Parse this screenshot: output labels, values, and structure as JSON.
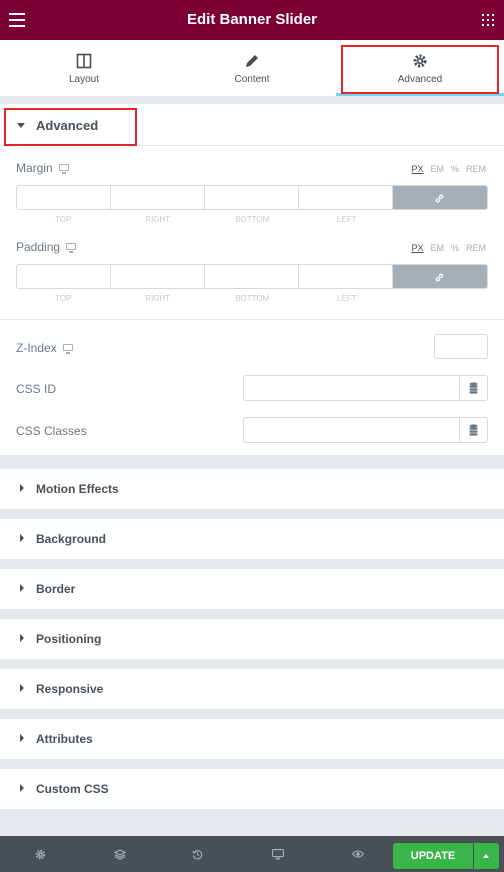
{
  "header": {
    "title": "Edit Banner Slider"
  },
  "tabs": [
    {
      "label": "Layout",
      "icon": "columns-icon"
    },
    {
      "label": "Content",
      "icon": "pencil-icon"
    },
    {
      "label": "Advanced",
      "icon": "gear-icon",
      "active": true
    }
  ],
  "advanced": {
    "title": "Advanced",
    "margin": {
      "label": "Margin",
      "units": [
        "PX",
        "EM",
        "%",
        "REM"
      ],
      "selected_unit": "PX",
      "fields": [
        "TOP",
        "RIGHT",
        "BOTTOM",
        "LEFT"
      ]
    },
    "padding": {
      "label": "Padding",
      "units": [
        "PX",
        "EM",
        "%",
        "REM"
      ],
      "selected_unit": "PX",
      "fields": [
        "TOP",
        "RIGHT",
        "BOTTOM",
        "LEFT"
      ]
    },
    "zindex": {
      "label": "Z-Index"
    },
    "css_id": {
      "label": "CSS ID"
    },
    "css_classes": {
      "label": "CSS Classes"
    }
  },
  "sections": [
    "Motion Effects",
    "Background",
    "Border",
    "Positioning",
    "Responsive",
    "Attributes",
    "Custom CSS"
  ],
  "footer": {
    "update_label": "UPDATE"
  },
  "colors": {
    "header": "#7b0036",
    "update": "#39b54a",
    "highlight": "#e2252b"
  }
}
